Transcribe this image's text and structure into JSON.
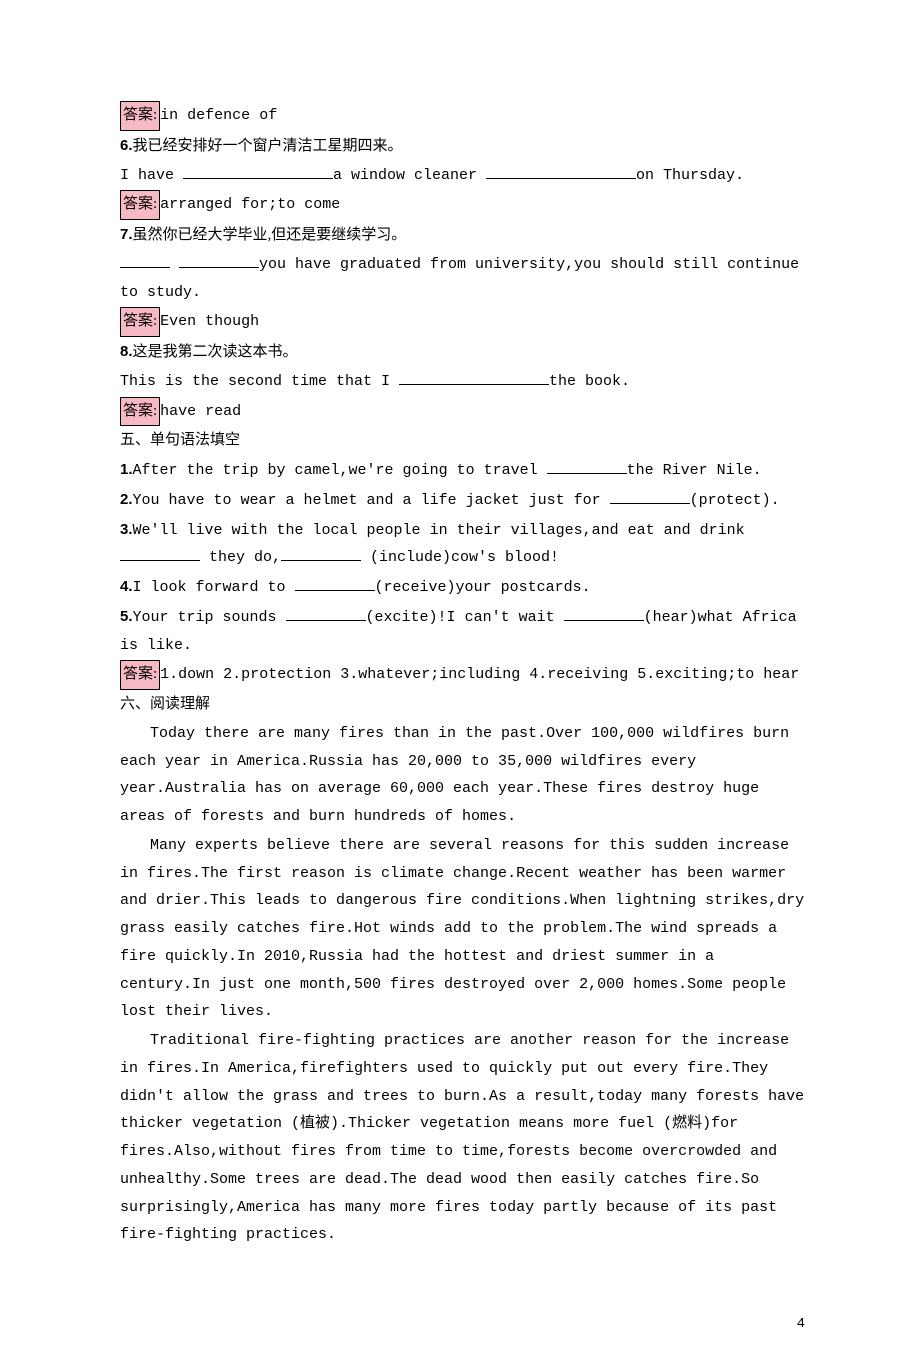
{
  "labels": {
    "answer": "答案:"
  },
  "ans5": "in defence of",
  "q6": {
    "cn": "我已经安排好一个窗户清洁工星期四来。",
    "en_a": "I have ",
    "en_b": "a window cleaner ",
    "en_c": "on Thursday.",
    "ans": "arranged for;to come"
  },
  "q7": {
    "cn": "虽然你已经大学毕业,但还是要继续学习。",
    "en_a": "you have graduated from university,you should still continue to study.",
    "ans": "Even though"
  },
  "q8": {
    "cn": "这是我第二次读这本书。",
    "en_a": "This is the second time that I ",
    "en_b": "the book.",
    "ans": "have read"
  },
  "section5": {
    "title": "五、单句语法填空",
    "i1a": "After the trip by camel,we're going to travel ",
    "i1b": "the River Nile.",
    "i2a": "You have to wear a helmet and a life jacket just for ",
    "i2b": "(protect).",
    "i3a": "We'll live with the local people in their villages,and eat and drink ",
    "i3b": " they do,",
    "i3c": " (include)cow's blood!",
    "i4a": "I look forward to ",
    "i4b": "(receive)your postcards.",
    "i5a": "Your trip sounds ",
    "i5b": "(excite)!I can't wait ",
    "i5c": "(hear)what Africa is like.",
    "ans": "1.down  2.protection  3.whatever;including  4.receiving  5.exciting;to hear"
  },
  "section6": {
    "title": "六、阅读理解",
    "p1": "Today there are many fires than in the past.Over 100,000 wildfires burn each year in America.Russia has 20,000 to 35,000 wildfires every year.Australia has on average 60,000 each year.These fires destroy huge areas of forests and burn hundreds of homes.",
    "p2": "Many experts believe there are several reasons for this sudden increase in fires.The first reason is climate change.Recent weather has been warmer and drier.This leads to dangerous fire conditions.When lightning strikes,dry grass easily catches fire.Hot winds add to the problem.The wind spreads a fire quickly.In 2010,Russia had the hottest and driest summer in a century.In just one month,500 fires destroyed over 2,000 homes.Some people lost their lives.",
    "p3": "Traditional fire-fighting practices are another reason for the increase in fires.In America,firefighters used to quickly put out every fire.They didn't allow the grass and trees to burn.As a result,today many forests have thicker vegetation (植被).Thicker vegetation means more fuel (燃料)for fires.Also,without fires from time to time,forests become overcrowded and unhealthy.Some trees are dead.The dead wood then easily catches fire.So surprisingly,America has many more fires today partly because of its past fire-fighting practices."
  },
  "pageNumber": "4"
}
